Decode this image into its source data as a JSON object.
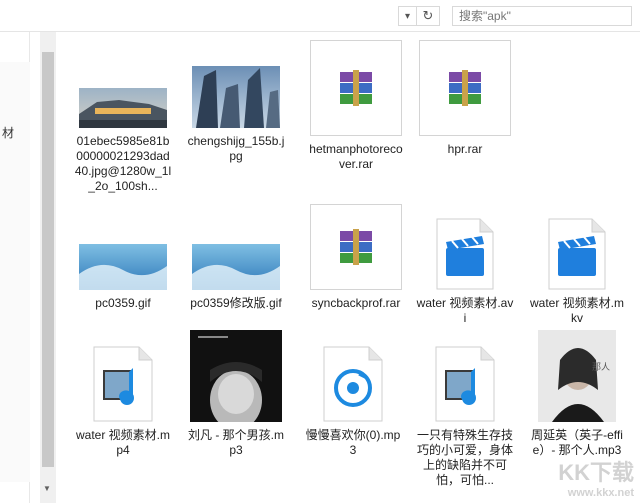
{
  "toolbar": {
    "search_placeholder": "搜索\"apk\"",
    "dropdown_icon": "chevron-down-icon",
    "refresh_icon": "refresh-icon"
  },
  "left_pane": {
    "label": "材"
  },
  "files": [
    {
      "name": "01ebec5985e81b00000021293dad40.jpg@1280w_1l_2o_100sh...",
      "kind": "photo-station"
    },
    {
      "name": "chengshijg_155b.jpg",
      "kind": "photo-city"
    },
    {
      "name": "hetmanphotorecover.rar",
      "kind": "rar"
    },
    {
      "name": "hpr.rar",
      "kind": "rar"
    },
    {
      "name": "pc0359.gif",
      "kind": "photo-wave"
    },
    {
      "name": "pc0359修改版.gif",
      "kind": "photo-wave"
    },
    {
      "name": "syncbackprof.rar",
      "kind": "rar"
    },
    {
      "name": "water 视频素材.avi",
      "kind": "video"
    },
    {
      "name": "water 视频素材.mkv",
      "kind": "video"
    },
    {
      "name": "water 视频素材.mp4",
      "kind": "media-doc"
    },
    {
      "name": "刘凡 - 那个男孩.mp3",
      "kind": "photo-dark"
    },
    {
      "name": "慢慢喜欢你(0).mp3",
      "kind": "audio-doc"
    },
    {
      "name": "一只有特殊生存技巧的小可爱，身体上的缺陷并不可怕，可怕...",
      "kind": "media-doc"
    },
    {
      "name": "周延英（英子-effie）- 那个人.mp3",
      "kind": "photo-woman"
    }
  ],
  "watermark": {
    "main": "KK下载",
    "sub": "www.kkx.net"
  }
}
